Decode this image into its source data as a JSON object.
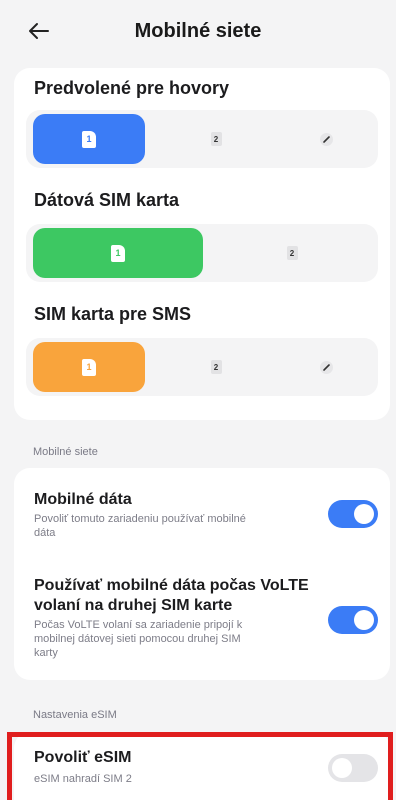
{
  "header": {
    "title": "Mobilné siete",
    "back_icon": "arrow-left-icon"
  },
  "sim_settings": {
    "calls": {
      "label": "Predvolené pre hovory",
      "options": [
        "1",
        "2"
      ],
      "selected": "1",
      "accent": "#3b7cf6"
    },
    "data": {
      "label": "Dátová SIM karta",
      "options": [
        "1",
        "2"
      ],
      "selected": "1",
      "accent": "#3dc862"
    },
    "sms": {
      "label": "SIM karta pre SMS",
      "options": [
        "1",
        "2"
      ],
      "selected": "1",
      "accent": "#f9a43c"
    }
  },
  "mobile_networks": {
    "group_label": "Mobilné siete",
    "mobile_data": {
      "title": "Mobilné dáta",
      "desc_line1": "Povoliť tomuto zariadeniu používať mobilné",
      "desc_line2": "dáta",
      "enabled": true
    },
    "volte_data": {
      "title_line1": "Používať mobilné dáta počas VoLTE",
      "title_line2": "volaní na druhej SIM karte",
      "desc_line1": "Počas VoLTE volaní sa zariadenie pripojí k",
      "desc_line2": "mobilnej dátovej sieti pomocou druhej SIM",
      "desc_line3": "karty",
      "enabled": true
    }
  },
  "esim": {
    "group_label": "Nastavenia eSIM",
    "title": "Povoliť eSIM",
    "desc": "eSIM nahradí SIM 2",
    "enabled": false
  },
  "colors": {
    "toggle_on": "#3b7cf6",
    "toggle_off": "#e4e4e7",
    "highlight": "#e01e1e"
  }
}
